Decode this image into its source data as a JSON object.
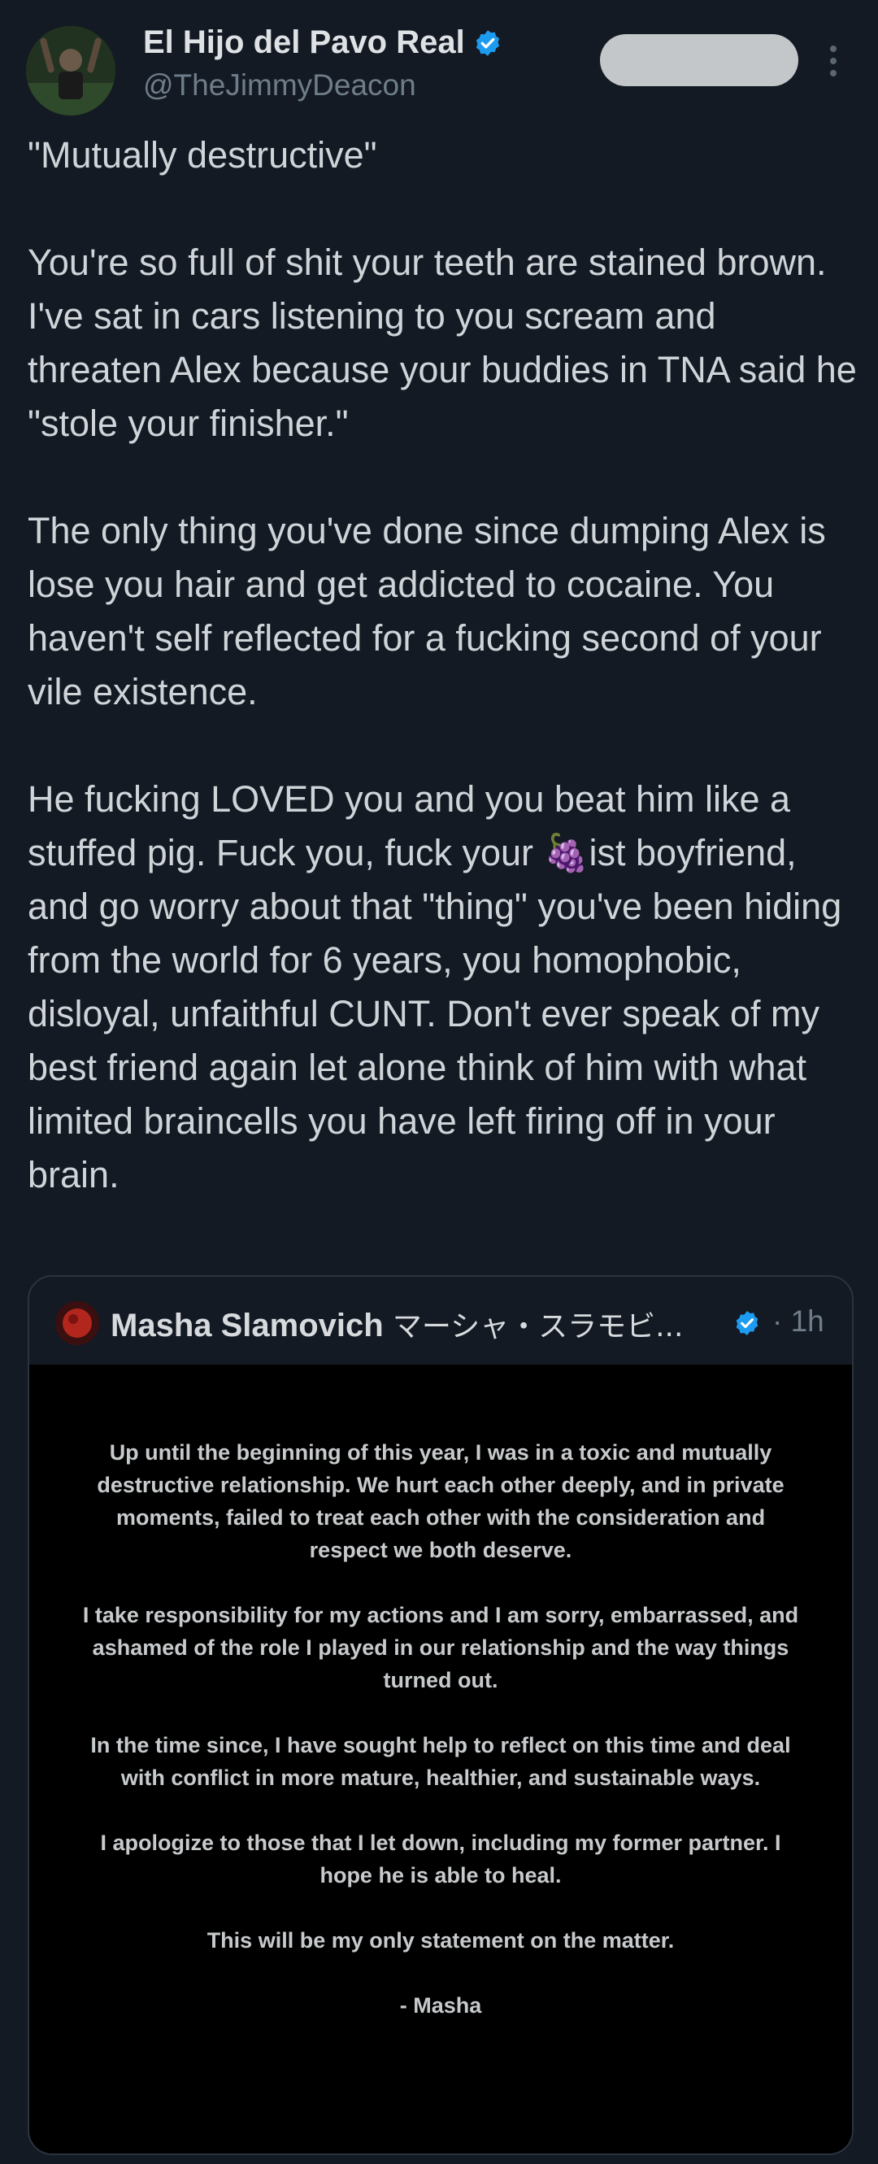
{
  "author": {
    "display_name": "El Hijo del Pavo Real",
    "handle": "@TheJimmyDeacon",
    "verified": true
  },
  "follow_button": {
    "label": ""
  },
  "tweet": {
    "text": "\"Mutually destructive\"\n\nYou're so full of shit your teeth are stained brown. I've sat in cars listening to you scream and threaten Alex because your buddies in TNA said he \"stole your finisher.\"\n\nThe only thing you've done since dumping Alex is lose you hair and get addicted to cocaine. You haven't self reflected for a fucking second of your vile existence.\n\nHe fucking LOVED you and you beat him like a stuffed pig. Fuck you, fuck your 🍇ist boyfriend, and go worry about that \"thing\" you've been hiding from the world for 6 years, you homophobic, disloyal, unfaithful CUNT. Don't ever speak of my best friend again let alone think of him with what limited braincells you have left firing off in your brain."
  },
  "quoted_tweet": {
    "display_name": "Masha Slamovich",
    "display_name_ja": "マーシャ・スラモビ...",
    "verified": true,
    "time": "· 1h",
    "statement_paragraphs": [
      "Up until the beginning of this year, I was in a toxic and mutually destructive relationship. We hurt each other deeply, and in private moments, failed to treat each other with the consideration and respect we both deserve.",
      "I take responsibility for my actions and I am sorry, embarrassed, and ashamed of the role I played in our relationship and the way things turned out.",
      "In the time since, I have sought help to reflect on this time and deal with conflict in more mature, healthier, and sustainable ways.",
      "I apologize to those that I let down, including my former partner. I hope he is able to heal.",
      "This will be my only statement on the matter.",
      "- Masha"
    ]
  },
  "colors": {
    "background": "#131a23",
    "verified_blue": "#1d9bf0",
    "secondary_text": "#6f7d8a",
    "statement_background": "#000000"
  },
  "icons": {
    "verified": "verified-badge-icon",
    "more": "more-vertical-icon"
  }
}
